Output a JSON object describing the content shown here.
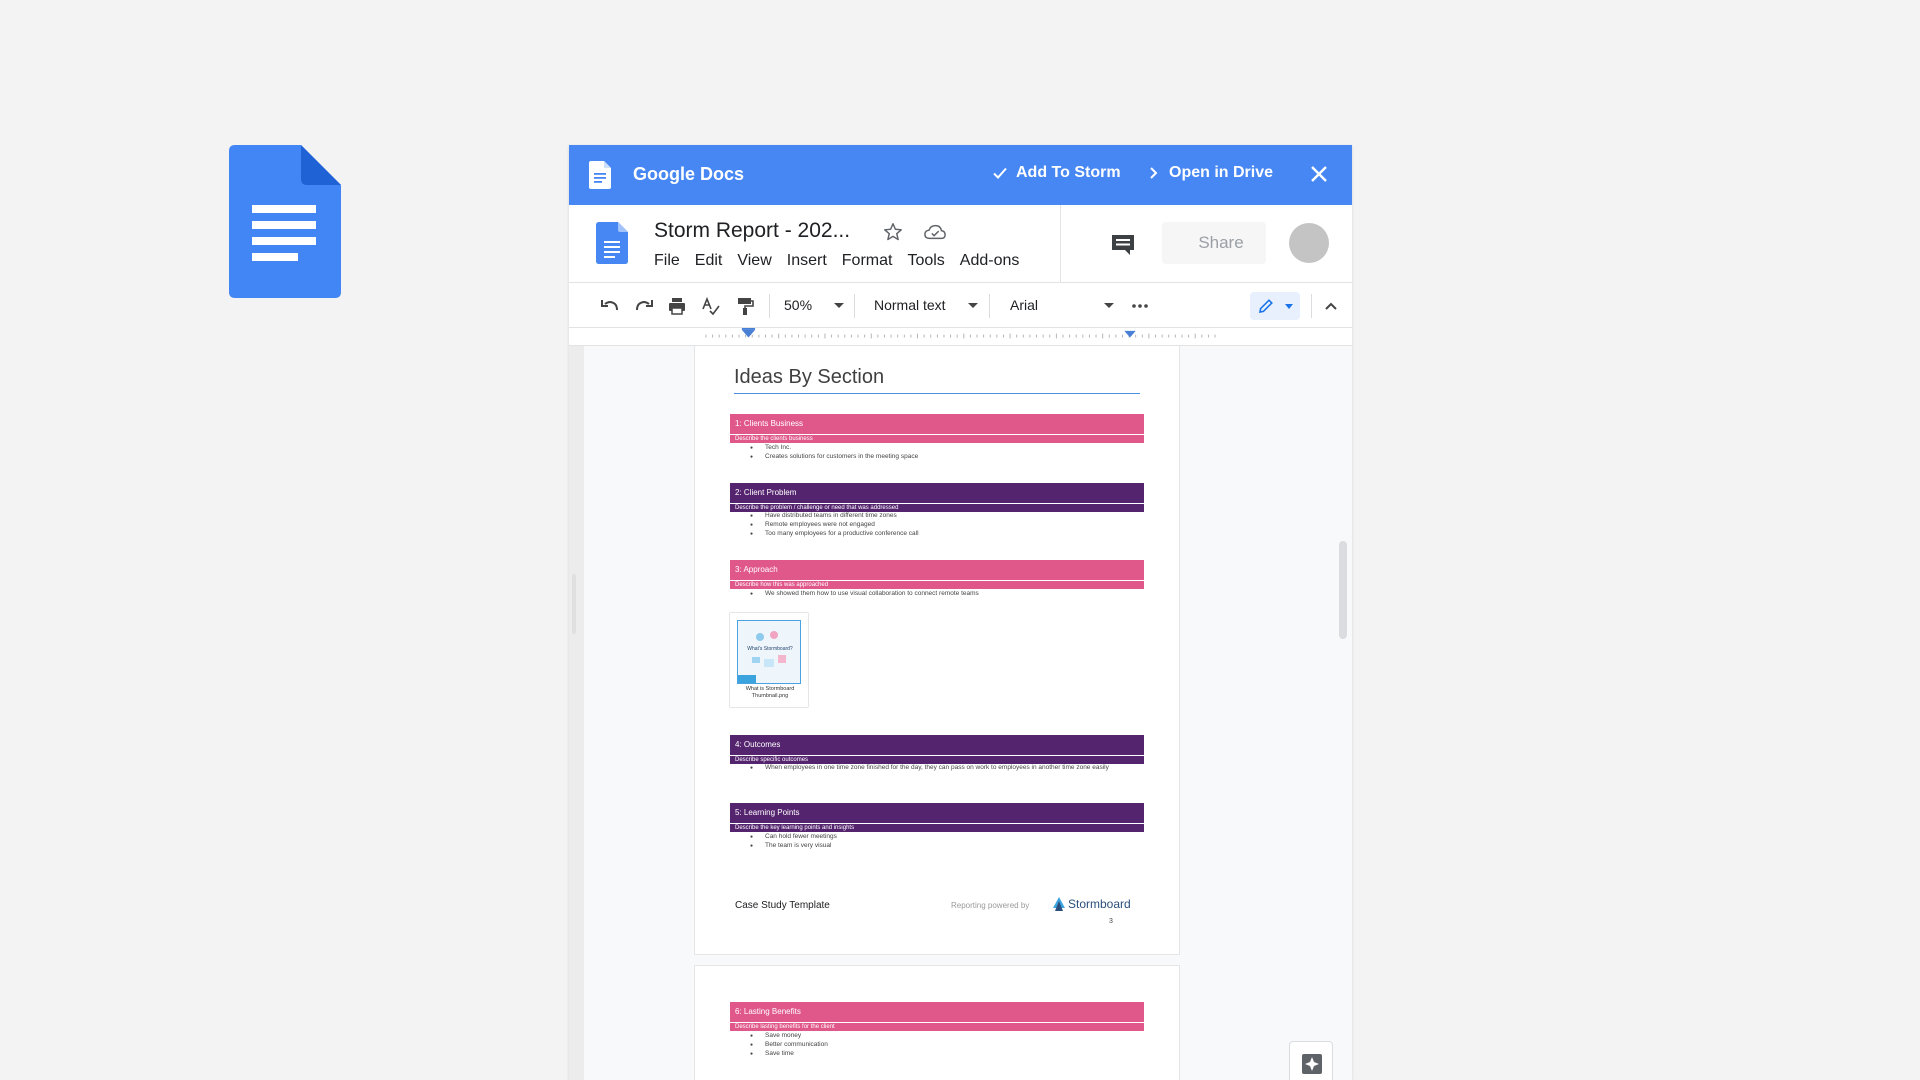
{
  "app": {
    "name": "Google Docs",
    "add_to_storm": "Add To Storm",
    "open_in_drive": "Open in Drive",
    "brand_color": "#4687f3"
  },
  "header": {
    "doc_title": "Storm Report - 202...",
    "menus": [
      "File",
      "Edit",
      "View",
      "Insert",
      "Format",
      "Tools",
      "Add-ons"
    ],
    "share_label": "Share"
  },
  "toolbar": {
    "zoom": "50%",
    "style": "Normal text",
    "font": "Arial"
  },
  "document": {
    "section_title": "Ideas By Section",
    "sections": [
      {
        "title": "1: Clients Business",
        "subtitle": "Describe the clients business",
        "color": "#e0578a",
        "bullets": [
          "Tech Inc.",
          "Creates solutions for customers in the meeting space"
        ]
      },
      {
        "title": "2: Client Problem",
        "subtitle": "Describe the problem / challenge or need that was addressed",
        "color": "#55246f",
        "bullets": [
          "Have distributed teams in different time zones",
          "Remote employees were not engaged",
          "Too many employees for a productive conference call"
        ]
      },
      {
        "title": "3: Approach",
        "subtitle": "Describe how this was approached",
        "color": "#e0578a",
        "bullets": [
          "We showed them how to use visual collaboration to connect remote teams"
        ]
      },
      {
        "title": "4: Outcomes",
        "subtitle": "Describe specific outcomes",
        "color": "#55246f",
        "bullets": [
          "When employees in one time zone finished for the day, they can pass on work to employees in another time zone easily"
        ]
      },
      {
        "title": "5: Learning Points",
        "subtitle": "Describe the key learning points and insights",
        "color": "#55246f",
        "bullets": [
          "Can hold fewer meetings",
          "The team is very visual"
        ]
      }
    ],
    "attachment": {
      "caption": "What is Stormboard Thumbnail.png",
      "thumb_text": "What's Stormboard?"
    },
    "footer": {
      "left": "Case Study Template",
      "powered": "Reporting powered by",
      "brand": "Stormboard",
      "page_number": "3"
    },
    "page2_section": {
      "title": "6: Lasting Benefits",
      "subtitle": "Describe lasting benefits for the client",
      "bullets": [
        "Save money",
        "Better communication",
        "Save time"
      ]
    }
  }
}
